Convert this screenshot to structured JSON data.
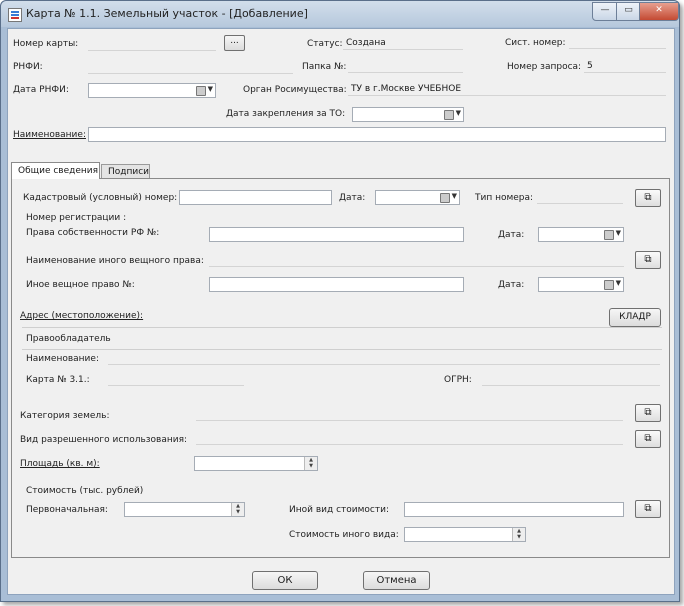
{
  "window": {
    "title": "Карта № 1.1. Земельный участок - [Добавление]",
    "min_glyph": "—",
    "max_glyph": "▭",
    "close_glyph": "✕"
  },
  "header": {
    "card_number_label": "Номер карты:",
    "status_label": "Статус:",
    "status_value": "Создана",
    "sys_number_label": "Сист. номер:",
    "rnfi_label": "РНФИ:",
    "folder_label": "Папка №:",
    "request_number_label": "Номер запроса:",
    "request_number_value": "5",
    "rnfi_date_label": "Дата РНФИ:",
    "organ_label": "Орган Росимущества:",
    "organ_value": "ТУ в г.Москве УЧЕБНОЕ",
    "assign_date_label": "Дата закрепления за ТО:",
    "name_label": "Наименование:",
    "browse_button": "..."
  },
  "tabs": [
    {
      "label": "Общие сведения"
    },
    {
      "label": "Подписи"
    }
  ],
  "general": {
    "cadastral_label": "Кадастровый (условный) номер:",
    "date_label": "Дата:",
    "number_type_label": "Тип номера:",
    "reg_number_label": "Номер регистрации :",
    "rf_ownership_label": "Права собственности РФ №:",
    "other_right_name_label": "Наименование иного вещного права:",
    "other_right_label": "Иное вещное право №:",
    "address_label": "Адрес (местоположение):",
    "kladr_button": "КЛАДР",
    "rightholder_label": "Правообладатель",
    "rh_name_label": "Наименование:",
    "card31_label": "Карта № 3.1.:",
    "ogrn_label": "ОГРН:",
    "land_category_label": "Категория земель:",
    "permitted_use_label": "Вид разрешенного использования:",
    "area_label": "Площадь (кв. м):",
    "cost_label": "Стоимость (тыс. рублей)",
    "initial_label": "Первоначальная:",
    "other_cost_type_label": "Иной вид стоимости:",
    "other_cost_value_label": "Стоимость иного вида:"
  },
  "footer": {
    "ok_button": "ОК",
    "cancel_button": "Отмена"
  },
  "icons": {
    "find": "binoculars-icon",
    "calendar": "calendar-icon"
  },
  "colors": {
    "frame": "#a9bed6",
    "client": "#f0f0f0",
    "close": "#c44a33"
  }
}
